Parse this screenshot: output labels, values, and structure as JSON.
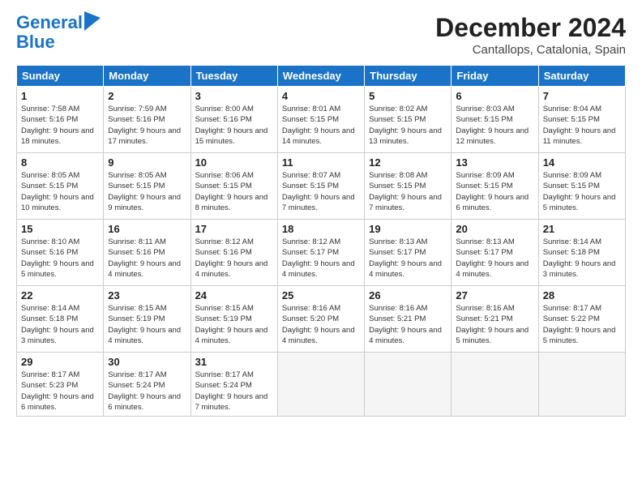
{
  "logo": {
    "line1": "General",
    "line2": "Blue"
  },
  "title": "December 2024",
  "subtitle": "Cantallops, Catalonia, Spain",
  "weekdays": [
    "Sunday",
    "Monday",
    "Tuesday",
    "Wednesday",
    "Thursday",
    "Friday",
    "Saturday"
  ],
  "weeks": [
    [
      {
        "day": 1,
        "sunrise": "7:58 AM",
        "sunset": "5:16 PM",
        "daylight": "9 hours and 18 minutes."
      },
      {
        "day": 2,
        "sunrise": "7:59 AM",
        "sunset": "5:16 PM",
        "daylight": "9 hours and 17 minutes."
      },
      {
        "day": 3,
        "sunrise": "8:00 AM",
        "sunset": "5:16 PM",
        "daylight": "9 hours and 15 minutes."
      },
      {
        "day": 4,
        "sunrise": "8:01 AM",
        "sunset": "5:15 PM",
        "daylight": "9 hours and 14 minutes."
      },
      {
        "day": 5,
        "sunrise": "8:02 AM",
        "sunset": "5:15 PM",
        "daylight": "9 hours and 13 minutes."
      },
      {
        "day": 6,
        "sunrise": "8:03 AM",
        "sunset": "5:15 PM",
        "daylight": "9 hours and 12 minutes."
      },
      {
        "day": 7,
        "sunrise": "8:04 AM",
        "sunset": "5:15 PM",
        "daylight": "9 hours and 11 minutes."
      }
    ],
    [
      {
        "day": 8,
        "sunrise": "8:05 AM",
        "sunset": "5:15 PM",
        "daylight": "9 hours and 10 minutes."
      },
      {
        "day": 9,
        "sunrise": "8:05 AM",
        "sunset": "5:15 PM",
        "daylight": "9 hours and 9 minutes."
      },
      {
        "day": 10,
        "sunrise": "8:06 AM",
        "sunset": "5:15 PM",
        "daylight": "9 hours and 8 minutes."
      },
      {
        "day": 11,
        "sunrise": "8:07 AM",
        "sunset": "5:15 PM",
        "daylight": "9 hours and 7 minutes."
      },
      {
        "day": 12,
        "sunrise": "8:08 AM",
        "sunset": "5:15 PM",
        "daylight": "9 hours and 7 minutes."
      },
      {
        "day": 13,
        "sunrise": "8:09 AM",
        "sunset": "5:15 PM",
        "daylight": "9 hours and 6 minutes."
      },
      {
        "day": 14,
        "sunrise": "8:09 AM",
        "sunset": "5:15 PM",
        "daylight": "9 hours and 5 minutes."
      }
    ],
    [
      {
        "day": 15,
        "sunrise": "8:10 AM",
        "sunset": "5:16 PM",
        "daylight": "9 hours and 5 minutes."
      },
      {
        "day": 16,
        "sunrise": "8:11 AM",
        "sunset": "5:16 PM",
        "daylight": "9 hours and 4 minutes."
      },
      {
        "day": 17,
        "sunrise": "8:12 AM",
        "sunset": "5:16 PM",
        "daylight": "9 hours and 4 minutes."
      },
      {
        "day": 18,
        "sunrise": "8:12 AM",
        "sunset": "5:17 PM",
        "daylight": "9 hours and 4 minutes."
      },
      {
        "day": 19,
        "sunrise": "8:13 AM",
        "sunset": "5:17 PM",
        "daylight": "9 hours and 4 minutes."
      },
      {
        "day": 20,
        "sunrise": "8:13 AM",
        "sunset": "5:17 PM",
        "daylight": "9 hours and 4 minutes."
      },
      {
        "day": 21,
        "sunrise": "8:14 AM",
        "sunset": "5:18 PM",
        "daylight": "9 hours and 3 minutes."
      }
    ],
    [
      {
        "day": 22,
        "sunrise": "8:14 AM",
        "sunset": "5:18 PM",
        "daylight": "9 hours and 3 minutes."
      },
      {
        "day": 23,
        "sunrise": "8:15 AM",
        "sunset": "5:19 PM",
        "daylight": "9 hours and 4 minutes."
      },
      {
        "day": 24,
        "sunrise": "8:15 AM",
        "sunset": "5:19 PM",
        "daylight": "9 hours and 4 minutes."
      },
      {
        "day": 25,
        "sunrise": "8:16 AM",
        "sunset": "5:20 PM",
        "daylight": "9 hours and 4 minutes."
      },
      {
        "day": 26,
        "sunrise": "8:16 AM",
        "sunset": "5:21 PM",
        "daylight": "9 hours and 4 minutes."
      },
      {
        "day": 27,
        "sunrise": "8:16 AM",
        "sunset": "5:21 PM",
        "daylight": "9 hours and 5 minutes."
      },
      {
        "day": 28,
        "sunrise": "8:17 AM",
        "sunset": "5:22 PM",
        "daylight": "9 hours and 5 minutes."
      }
    ],
    [
      {
        "day": 29,
        "sunrise": "8:17 AM",
        "sunset": "5:23 PM",
        "daylight": "9 hours and 6 minutes."
      },
      {
        "day": 30,
        "sunrise": "8:17 AM",
        "sunset": "5:24 PM",
        "daylight": "9 hours and 6 minutes."
      },
      {
        "day": 31,
        "sunrise": "8:17 AM",
        "sunset": "5:24 PM",
        "daylight": "9 hours and 7 minutes."
      },
      null,
      null,
      null,
      null
    ]
  ]
}
